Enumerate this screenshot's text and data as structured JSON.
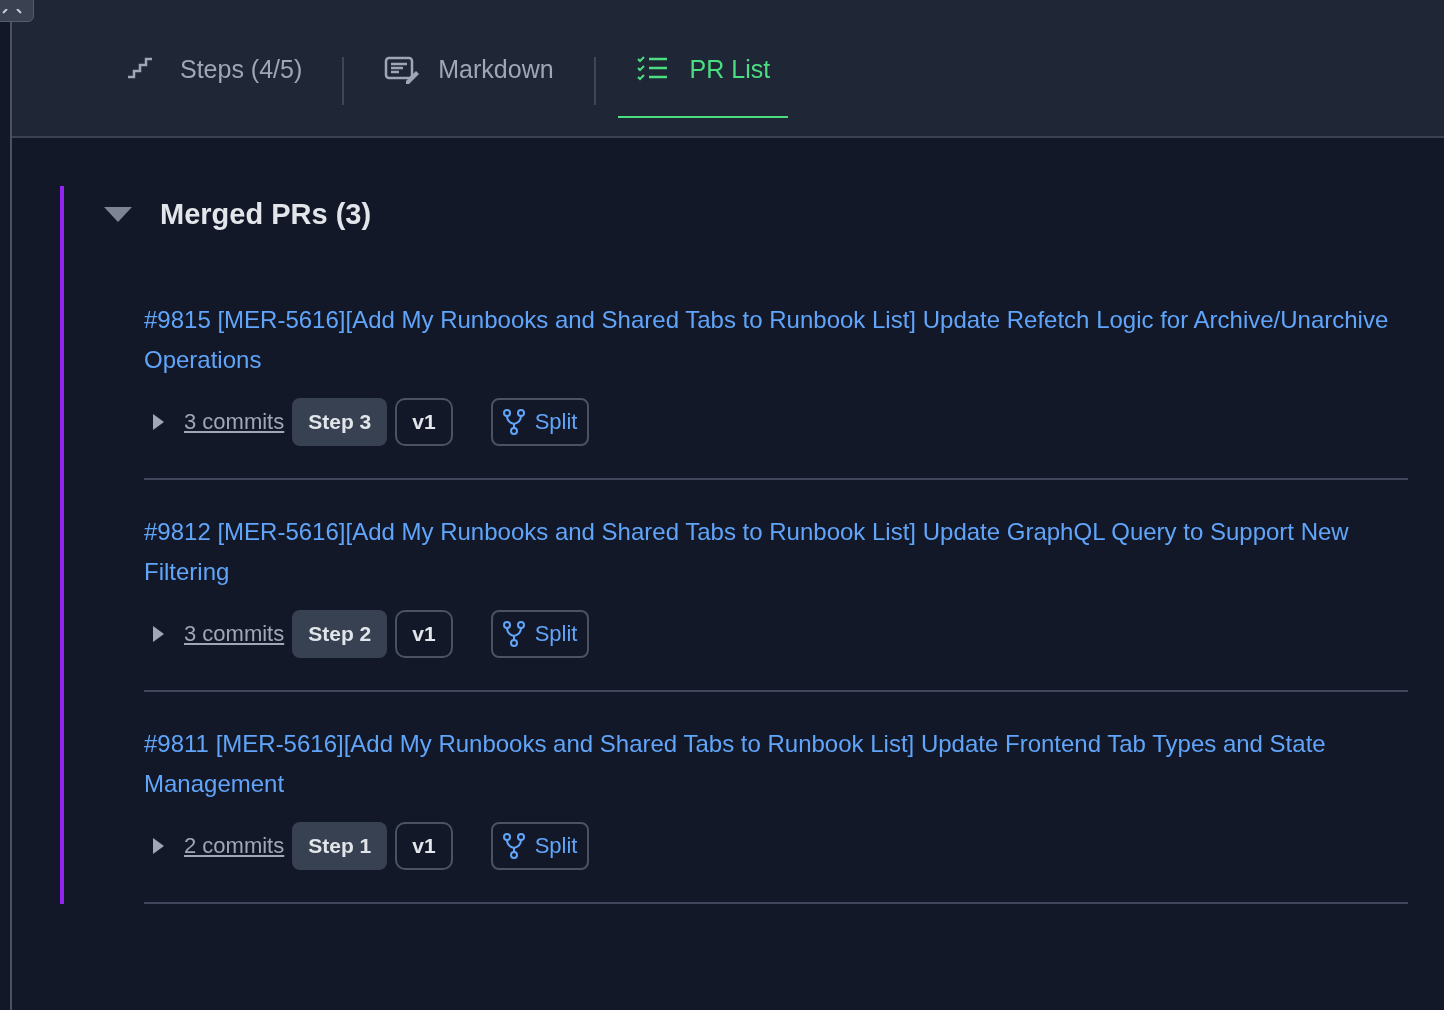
{
  "tabs": [
    {
      "label": "Steps (4/5)",
      "kind": "steps",
      "selected": false
    },
    {
      "label": "Markdown",
      "kind": "markdown",
      "selected": false
    },
    {
      "label": "PR List",
      "kind": "list",
      "selected": true
    }
  ],
  "section": {
    "title": "Merged PRs (3)",
    "expanded": true,
    "prs": [
      {
        "title": "#9815 [MER-5616][Add My Runbooks and Shared Tabs to Runbook List] Update Refetch Logic for Archive/Unarchive Operations",
        "commits": "3 commits",
        "commits_expanded": false,
        "step": "Step 3",
        "version": "v1",
        "action": "Split"
      },
      {
        "title": "#9812 [MER-5616][Add My Runbooks and Shared Tabs to Runbook List] Update GraphQL Query to Support New Filtering",
        "commits": "3 commits",
        "commits_expanded": false,
        "step": "Step 2",
        "version": "v1",
        "action": "Split"
      },
      {
        "title": "#9811 [MER-5616][Add My Runbooks and Shared Tabs to Runbook List] Update Frontend Tab Types and State Management",
        "commits": "2 commits",
        "commits_expanded": false,
        "step": "Step 1",
        "version": "v1",
        "action": "Split"
      }
    ]
  }
}
